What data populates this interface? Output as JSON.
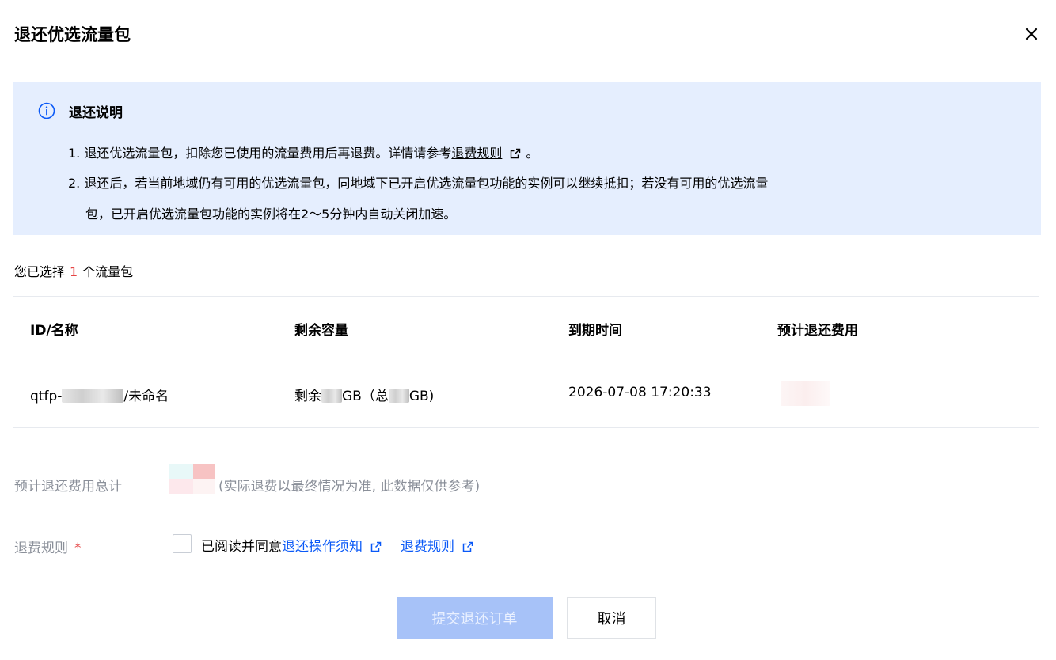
{
  "dialog": {
    "title": "退还优选流量包",
    "close_icon": "close-icon"
  },
  "notice": {
    "icon": "info-icon",
    "title": "退还说明",
    "line1_text": "1. 退还优选流量包，扣除您已使用的流量费用后再退费。详情请参考",
    "line1_link": "退费规则",
    "line1_end": "。",
    "line2": "2. 退还后，若当前地域仍有可用的优选流量包，同地域下已开启优选流量包功能的实例可以继续抵扣；若没有可用的优选流量",
    "line3": "包，已开启优选流量包功能的实例将在2～5分钟内自动关闭加速。"
  },
  "selection": {
    "prefix": "您已选择",
    "count": "1",
    "suffix": "个流量包"
  },
  "table": {
    "headers": [
      "ID/名称",
      "剩余容量",
      "到期时间",
      "预计退还费用"
    ],
    "rows": [
      {
        "id_prefix": "qtfp-",
        "id_suffix": "/未命名",
        "remaining_a": "剩余",
        "remaining_b": "GB（总",
        "remaining_c": "GB)",
        "expire": "2026-07-08 17:20:33"
      }
    ]
  },
  "fee": {
    "label": "预计退还费用总计",
    "note": "(实际退费以最终情况为准, 此数据仅供参考)"
  },
  "rule": {
    "label": "退费规则",
    "required_mark": "*",
    "agree_text": "已阅读并同意",
    "link1": "退还操作须知",
    "link2": "退费规则",
    "link_icon": "external-link-icon"
  },
  "buttons": {
    "submit": "提交退还订单",
    "cancel": "取消"
  },
  "colors": {
    "accent": "#0a59f7",
    "notice_bg": "#e5eefe",
    "required": "#e54545",
    "submit_disabled": "#a7c2f8"
  }
}
